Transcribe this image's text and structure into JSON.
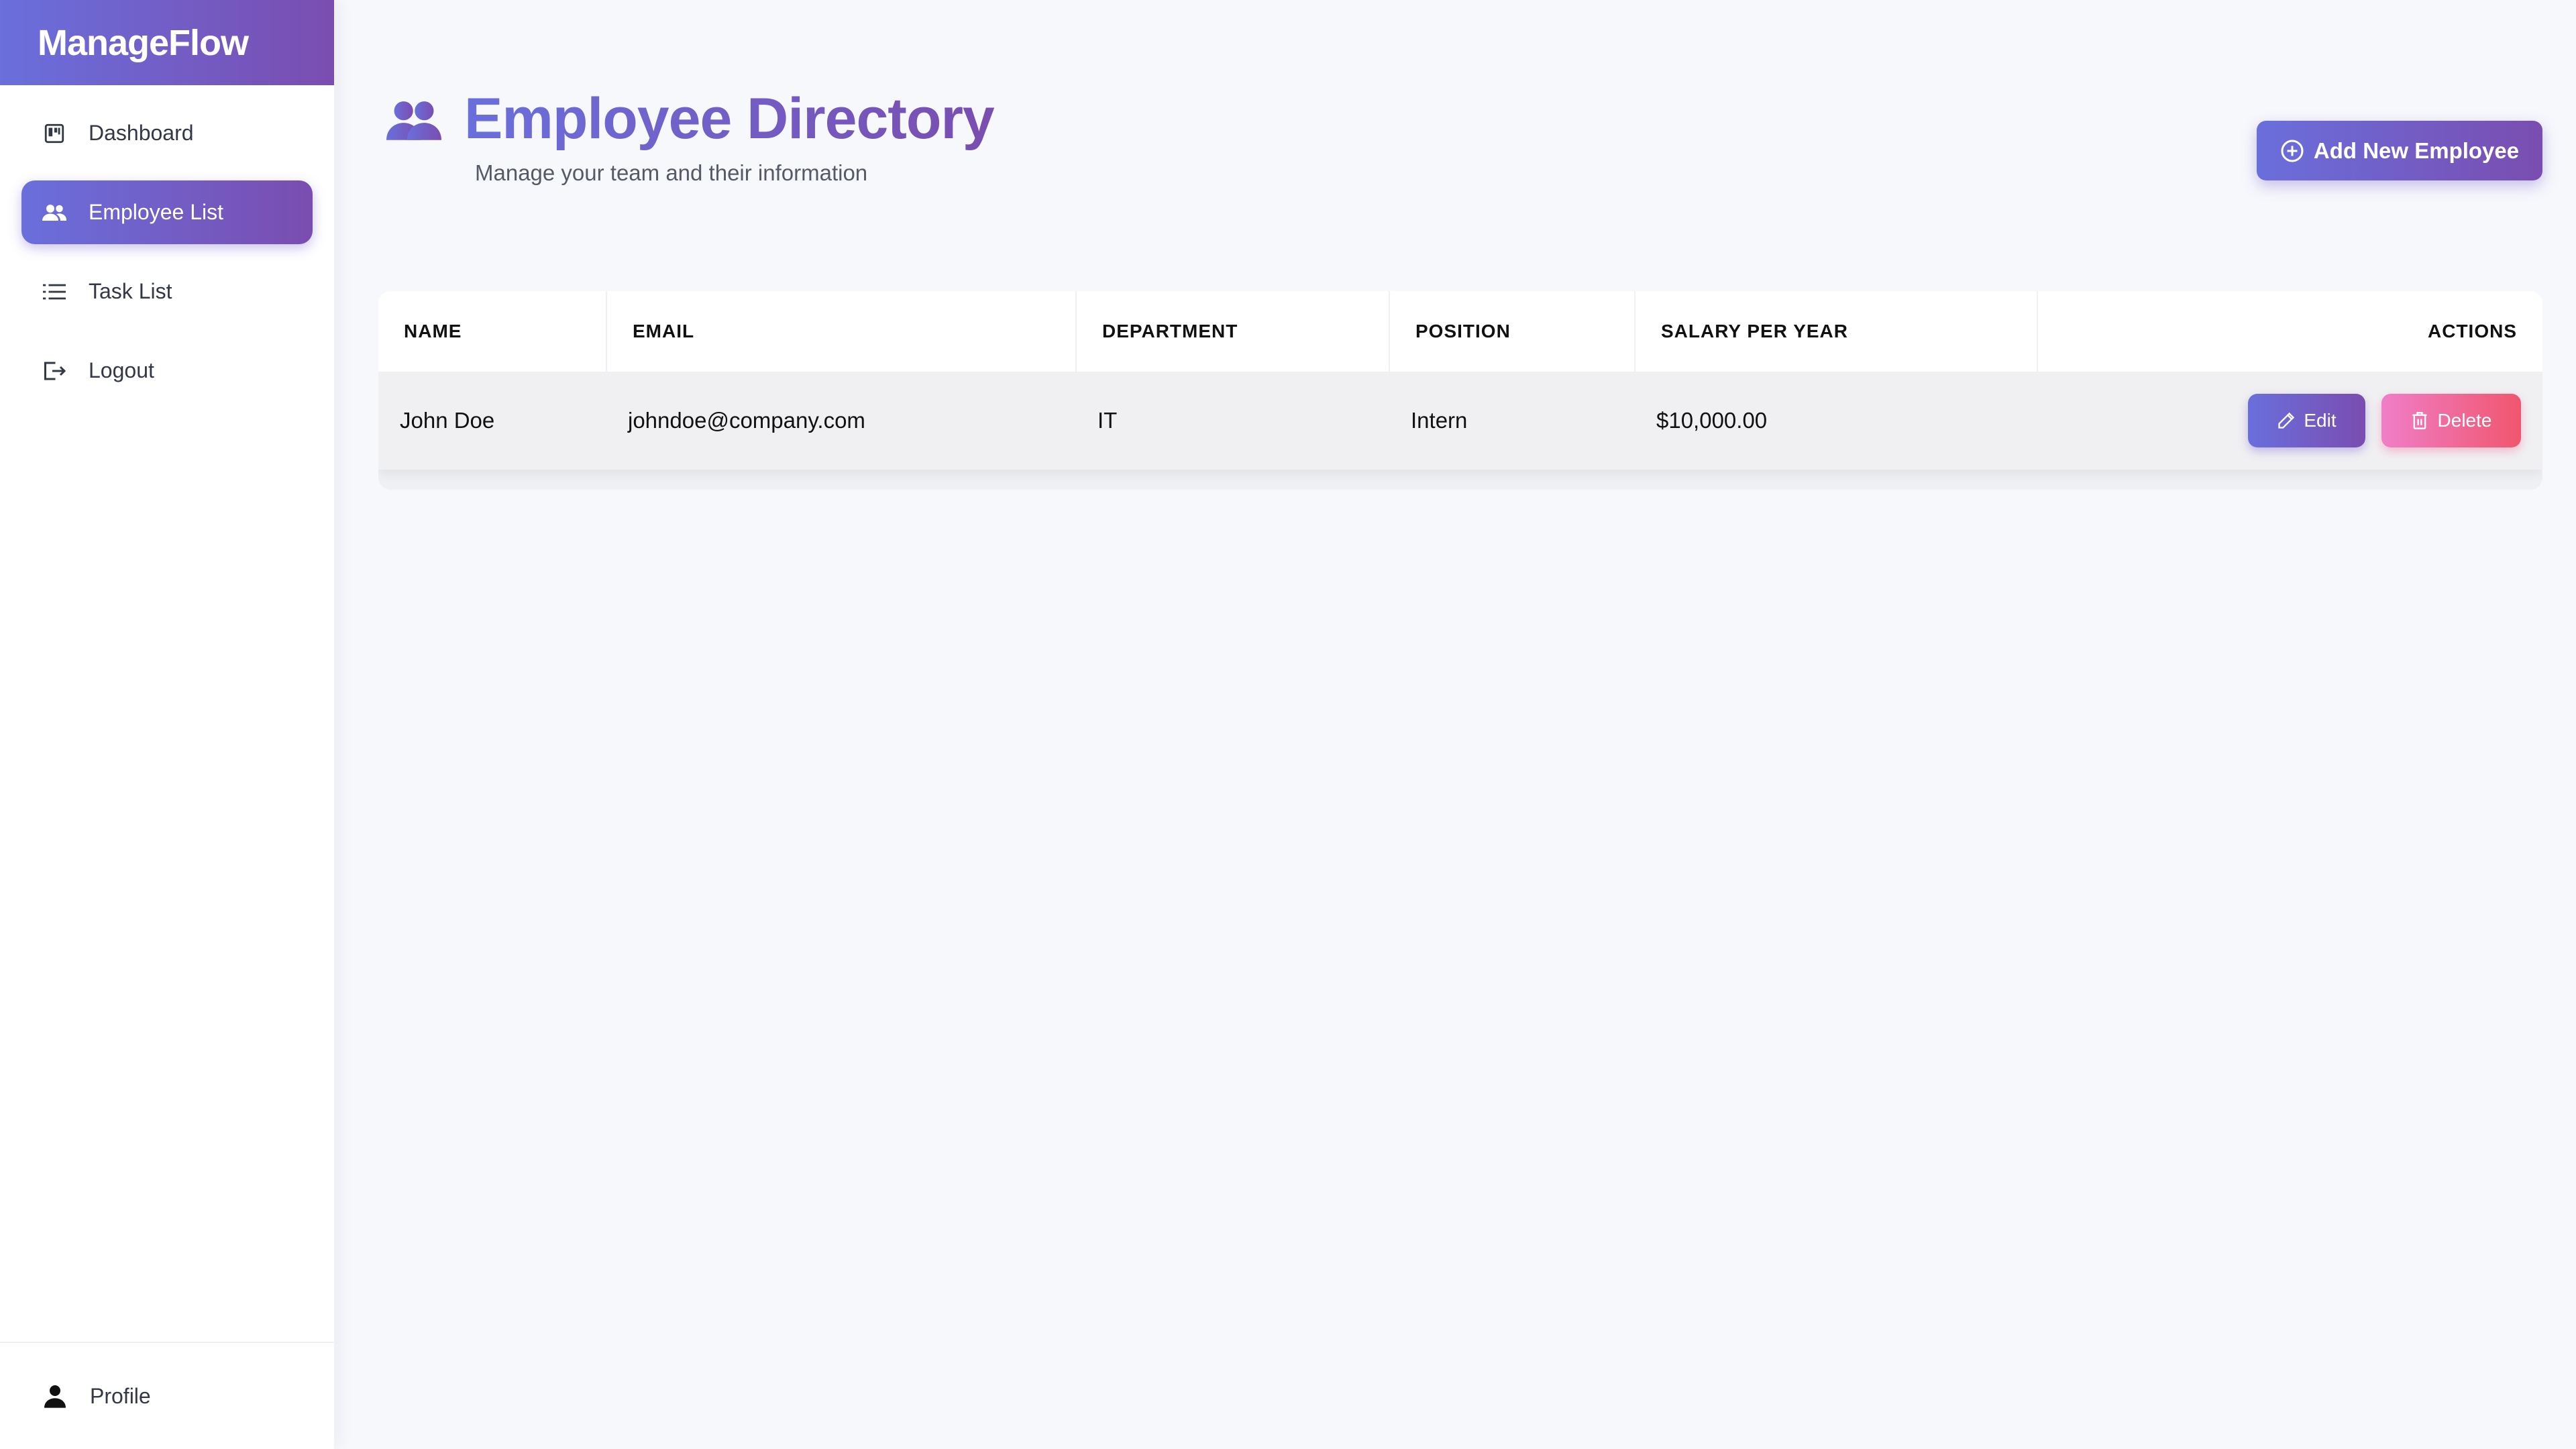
{
  "app": {
    "brand": "ManageFlow"
  },
  "colors": {
    "accent_start": "#6a6fdc",
    "accent_end": "#7a4db0",
    "danger_start": "#f07ec8",
    "danger_end": "#f0566e"
  },
  "sidebar": {
    "items": [
      {
        "label": "Dashboard",
        "icon": "dashboard-icon",
        "active": false
      },
      {
        "label": "Employee List",
        "icon": "users-icon",
        "active": true
      },
      {
        "label": "Task List",
        "icon": "list-icon",
        "active": false
      },
      {
        "label": "Logout",
        "icon": "logout-icon",
        "active": false
      }
    ],
    "footer": {
      "label": "Profile",
      "icon": "user-icon"
    }
  },
  "header": {
    "title": "Employee Directory",
    "subtitle": "Manage your team and their information",
    "title_icon": "users-icon"
  },
  "toolbar": {
    "add_label": "Add New Employee",
    "add_icon": "plus-circle-icon"
  },
  "table": {
    "columns": [
      "NAME",
      "EMAIL",
      "DEPARTMENT",
      "POSITION",
      "SALARY PER YEAR",
      "ACTIONS"
    ],
    "rows": [
      {
        "name": "John Doe",
        "email": "johndoe@company.com",
        "department": "IT",
        "position": "Intern",
        "salary": "$10,000.00"
      }
    ],
    "edit_label": "Edit",
    "delete_label": "Delete"
  }
}
